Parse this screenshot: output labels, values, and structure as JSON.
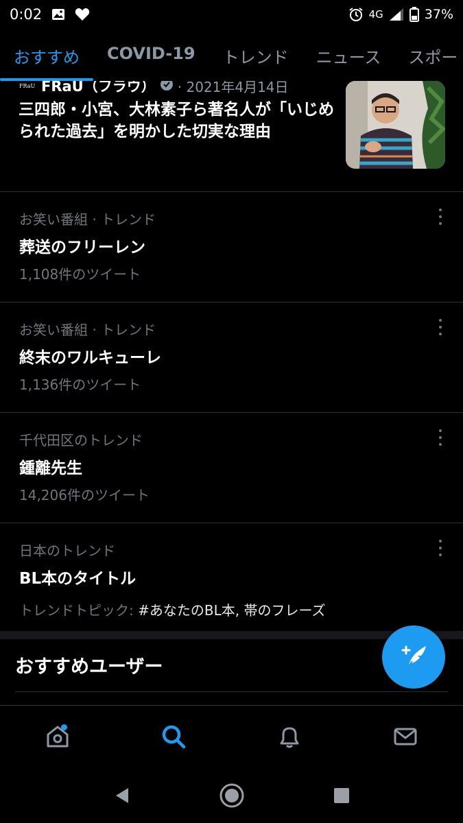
{
  "status_bar": {
    "time": "0:02",
    "network": "4G",
    "battery": "37%"
  },
  "tabs": [
    {
      "label": "おすすめ",
      "active": true
    },
    {
      "label": "COVID-19",
      "active": false
    },
    {
      "label": "トレンド",
      "active": false
    },
    {
      "label": "ニュース",
      "active": false
    },
    {
      "label": "スポー",
      "active": false
    }
  ],
  "news": {
    "source_logo": "FRaU",
    "source": "FRaU（フラウ）",
    "date": "· 2021年4月14日",
    "title": "三四郎・小宮、大林素子ら著名人が「いじめられた過去」を明かした切実な理由"
  },
  "trends": [
    {
      "context": "お笑い番組 · トレンド",
      "name": "葬送のフリーレン",
      "count": "1,108件のツイート"
    },
    {
      "context": "お笑い番組 · トレンド",
      "name": "終末のワルキューレ",
      "count": "1,136件のツイート"
    },
    {
      "context": "千代田区のトレンド",
      "name": "鍾離先生",
      "count": "14,206件のツイート"
    }
  ],
  "topic_trend": {
    "context": "日本のトレンド",
    "name": "BL本のタイトル",
    "topic_label": "トレンドトピック: ",
    "topic_tags": "#あなたのBL本, 帯のフレーズ"
  },
  "section": {
    "title": "おすすめユーザー"
  },
  "icons": {
    "home": "home-icon",
    "search": "search-icon",
    "notifications": "bell-icon",
    "messages": "mail-icon",
    "compose": "compose-tweet-icon"
  },
  "colors": {
    "accent": "#1d9bf0",
    "background": "#000000",
    "secondary_text": "#71767b"
  }
}
